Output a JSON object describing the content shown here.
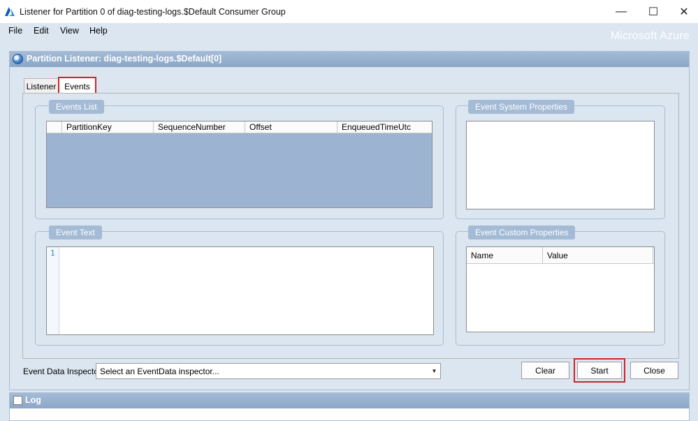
{
  "window": {
    "title": "Listener for Partition 0 of diag-testing-logs.$Default Consumer Group",
    "minimize_glyph": "—",
    "maximize_glyph": "☐",
    "close_glyph": "✕"
  },
  "menu": {
    "items": [
      "File",
      "Edit",
      "View",
      "Help"
    ],
    "brand": "Microsoft Azure"
  },
  "panel": {
    "title": "Partition Listener: diag-testing-logs.$Default[0]"
  },
  "tabs": [
    {
      "label": "Listener",
      "active": false
    },
    {
      "label": "Events",
      "active": true
    }
  ],
  "events_list": {
    "label": "Events List",
    "columns": [
      "PartitionKey",
      "SequenceNumber",
      "Offset",
      "EnqueuedTimeUtc"
    ],
    "rows": []
  },
  "event_system_properties": {
    "label": "Event System Properties"
  },
  "event_text": {
    "label": "Event Text",
    "line_numbers": [
      "1"
    ],
    "content": ""
  },
  "event_custom_properties": {
    "label": "Event Custom Properties",
    "columns": [
      "Name",
      "Value"
    ]
  },
  "inspector": {
    "label": "Event Data Inspector:",
    "value": "Select an EventData inspector..."
  },
  "buttons": {
    "clear": "Clear",
    "start": "Start",
    "close": "Close"
  },
  "log": {
    "label": "Log"
  },
  "colors": {
    "accent": "#a4bbd6",
    "highlight": "#d4202a",
    "grid_bg": "#9cb4d1"
  }
}
